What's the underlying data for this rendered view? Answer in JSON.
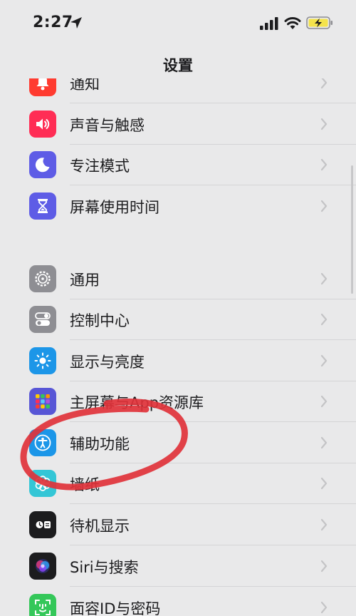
{
  "status_bar": {
    "time": "2:27",
    "icons": [
      "location-arrow-icon",
      "cellular-signal-icon",
      "wifi-icon",
      "battery-charging-icon"
    ]
  },
  "nav": {
    "title": "设置"
  },
  "settings": [
    {
      "label": "通知",
      "icon": "bell-icon",
      "color": "#ff3b30"
    },
    {
      "label": "声音与触感",
      "icon": "speaker-icon",
      "color": "#ff2d55"
    },
    {
      "label": "专注模式",
      "icon": "moon-icon",
      "color": "#5e5ce6"
    },
    {
      "label": "屏幕使用时间",
      "icon": "hourglass-icon",
      "color": "#5e5ce6"
    },
    {
      "label": "通用",
      "icon": "gear-icon",
      "color": "#8e8e93"
    },
    {
      "label": "控制中心",
      "icon": "toggles-icon",
      "color": "#8e8e93"
    },
    {
      "label": "显示与亮度",
      "icon": "sun-icon",
      "color": "#1c96e8"
    },
    {
      "label": "主屏幕与App资源库",
      "icon": "app-grid-icon",
      "color": "#5856d6"
    },
    {
      "label": "辅助功能",
      "icon": "accessibility-icon",
      "color": "#1c96e8"
    },
    {
      "label": "墙纸",
      "icon": "flower-icon",
      "color": "#34c6d6"
    },
    {
      "label": "待机显示",
      "icon": "standby-icon",
      "color": "#1c1c1e"
    },
    {
      "label": "Siri与搜索",
      "icon": "siri-icon",
      "color": "#1c1c1e"
    },
    {
      "label": "面容ID与密码",
      "icon": "face-id-icon",
      "color": "#34c759"
    }
  ],
  "annotation": {
    "color": "#e0323a"
  }
}
